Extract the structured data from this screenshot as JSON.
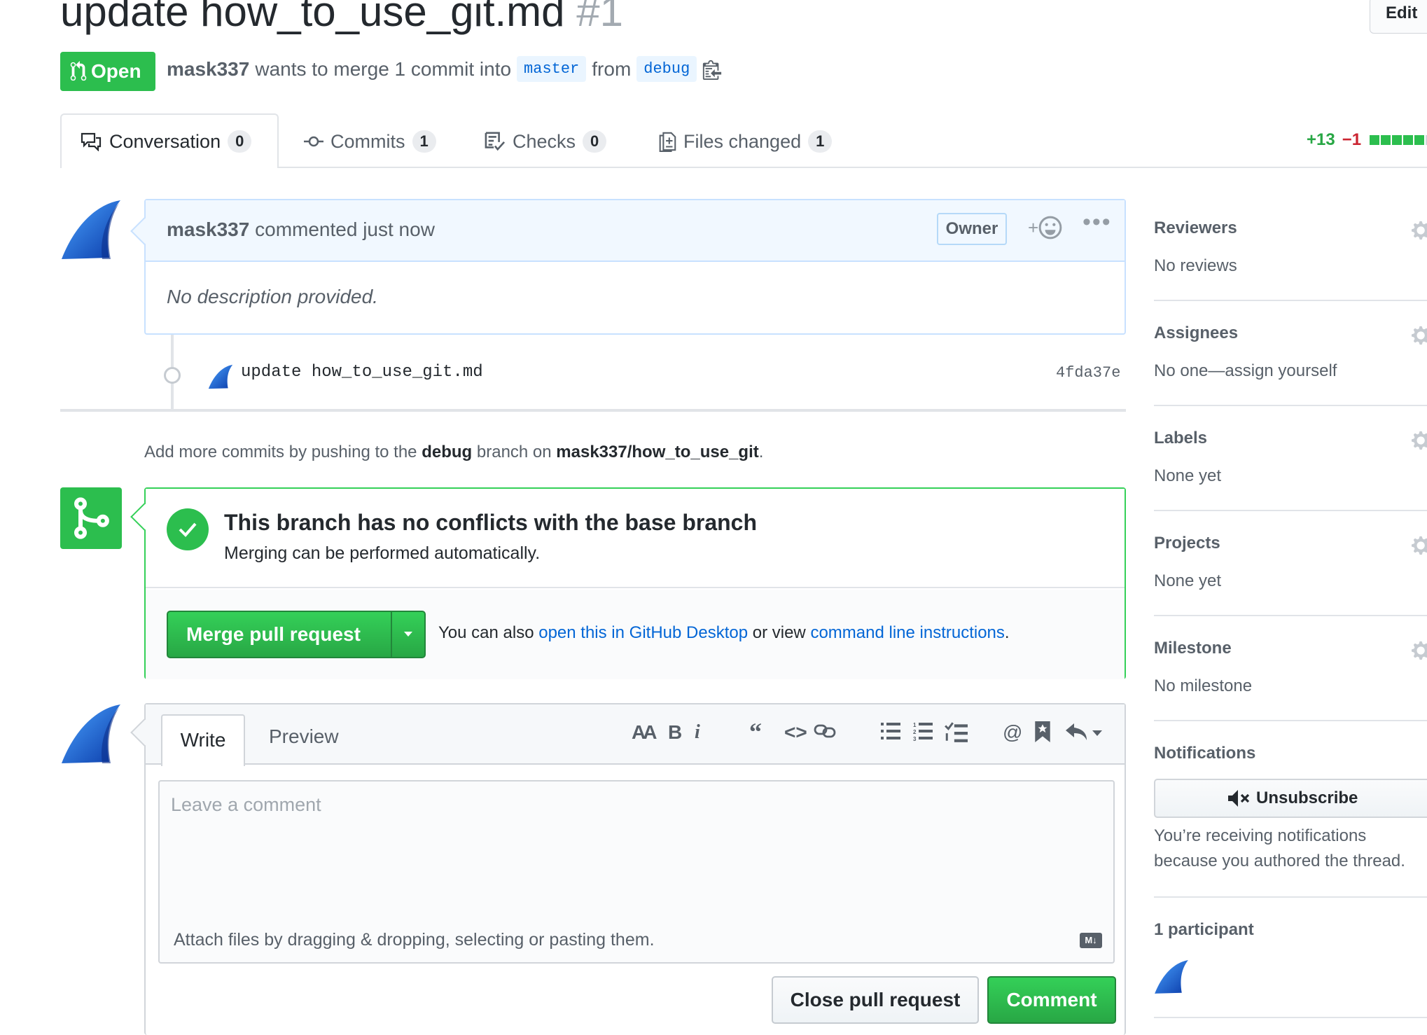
{
  "header": {
    "title": "update how_to_use_git.md",
    "number": "#1",
    "edit_label": "Edit"
  },
  "status": {
    "state": "Open",
    "author": "mask337",
    "text_merge": "wants to merge 1 commit into",
    "base_branch": "master",
    "text_from": "from",
    "head_branch": "debug"
  },
  "tabs": [
    {
      "label": "Conversation",
      "count": "0"
    },
    {
      "label": "Commits",
      "count": "1"
    },
    {
      "label": "Checks",
      "count": "0"
    },
    {
      "label": "Files changed",
      "count": "1"
    }
  ],
  "diffstat": {
    "additions": "+13",
    "deletions": "−1",
    "colors": [
      "#2cbe4e",
      "#2cbe4e",
      "#2cbe4e",
      "#2cbe4e",
      "#2cbe4e",
      "#d1d5da"
    ]
  },
  "comment": {
    "author": "mask337",
    "action": "commented just now",
    "badge": "Owner",
    "body": "No description provided."
  },
  "commit": {
    "message": "update how_to_use_git.md",
    "sha": "4fda37e"
  },
  "push_hint": {
    "prefix": "Add more commits by pushing to the",
    "branch": "debug",
    "middle": "branch on",
    "repo": "mask337/how_to_use_git",
    "suffix": "."
  },
  "merge": {
    "title": "This branch has no conflicts with the base branch",
    "subtitle": "Merging can be performed automatically.",
    "button": "Merge pull request",
    "hint_prefix": "You can also",
    "link_desktop": "open this in GitHub Desktop",
    "hint_middle": "or view",
    "link_cli": "command line instructions",
    "hint_suffix": "."
  },
  "form": {
    "tab_write": "Write",
    "tab_preview": "Preview",
    "placeholder": "Leave a comment",
    "attach": "Attach files by dragging & dropping, selecting or pasting them.",
    "md_badge": "M↓",
    "close_button": "Close pull request",
    "comment_button": "Comment",
    "toolbar": [
      "header-icon",
      "bold-icon",
      "italic-icon",
      "quote-icon",
      "code-icon",
      "link-icon",
      "bullet-list-icon",
      "numbered-list-icon",
      "task-list-icon",
      "mention-icon",
      "bookmark-icon",
      "reply-icon"
    ]
  },
  "sidebar": {
    "reviewers": {
      "title": "Reviewers",
      "value": "No reviews"
    },
    "assignees": {
      "title": "Assignees",
      "value": "No one—assign yourself"
    },
    "labels": {
      "title": "Labels",
      "value": "None yet"
    },
    "projects": {
      "title": "Projects",
      "value": "None yet"
    },
    "milestone": {
      "title": "Milestone",
      "value": "No milestone"
    },
    "notifications": {
      "title": "Notifications",
      "button": "Unsubscribe",
      "reason_line1": "You’re receiving notifications",
      "reason_line2": "because you authored the thread."
    },
    "participants": {
      "title": "1 participant"
    }
  },
  "colors": {
    "green": "#2cbe4e",
    "blue_link": "#0366d6",
    "red": "#cb2431"
  }
}
